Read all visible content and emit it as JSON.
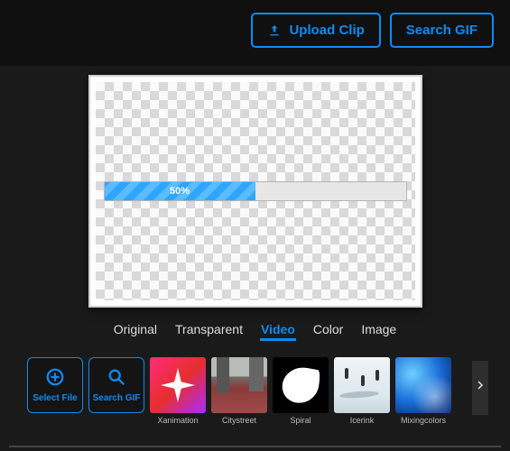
{
  "header": {
    "upload_label": "Upload Clip",
    "search_gif_label": "Search GIF"
  },
  "canvas": {
    "progress_percent": 50,
    "progress_label": "50%"
  },
  "tabs": [
    {
      "label": "Original",
      "active": false
    },
    {
      "label": "Transparent",
      "active": false
    },
    {
      "label": "Video",
      "active": true
    },
    {
      "label": "Color",
      "active": false
    },
    {
      "label": "Image",
      "active": false
    }
  ],
  "toolbar": {
    "select_file_label": "Select File",
    "search_gif_label": "Search GIF"
  },
  "thumbnails": [
    {
      "label": "Xanimation"
    },
    {
      "label": "Citystreet"
    },
    {
      "label": "Spiral"
    },
    {
      "label": "Icerink"
    },
    {
      "label": "Mixingcolors"
    }
  ],
  "colors": {
    "accent": "#0d8bf2"
  }
}
